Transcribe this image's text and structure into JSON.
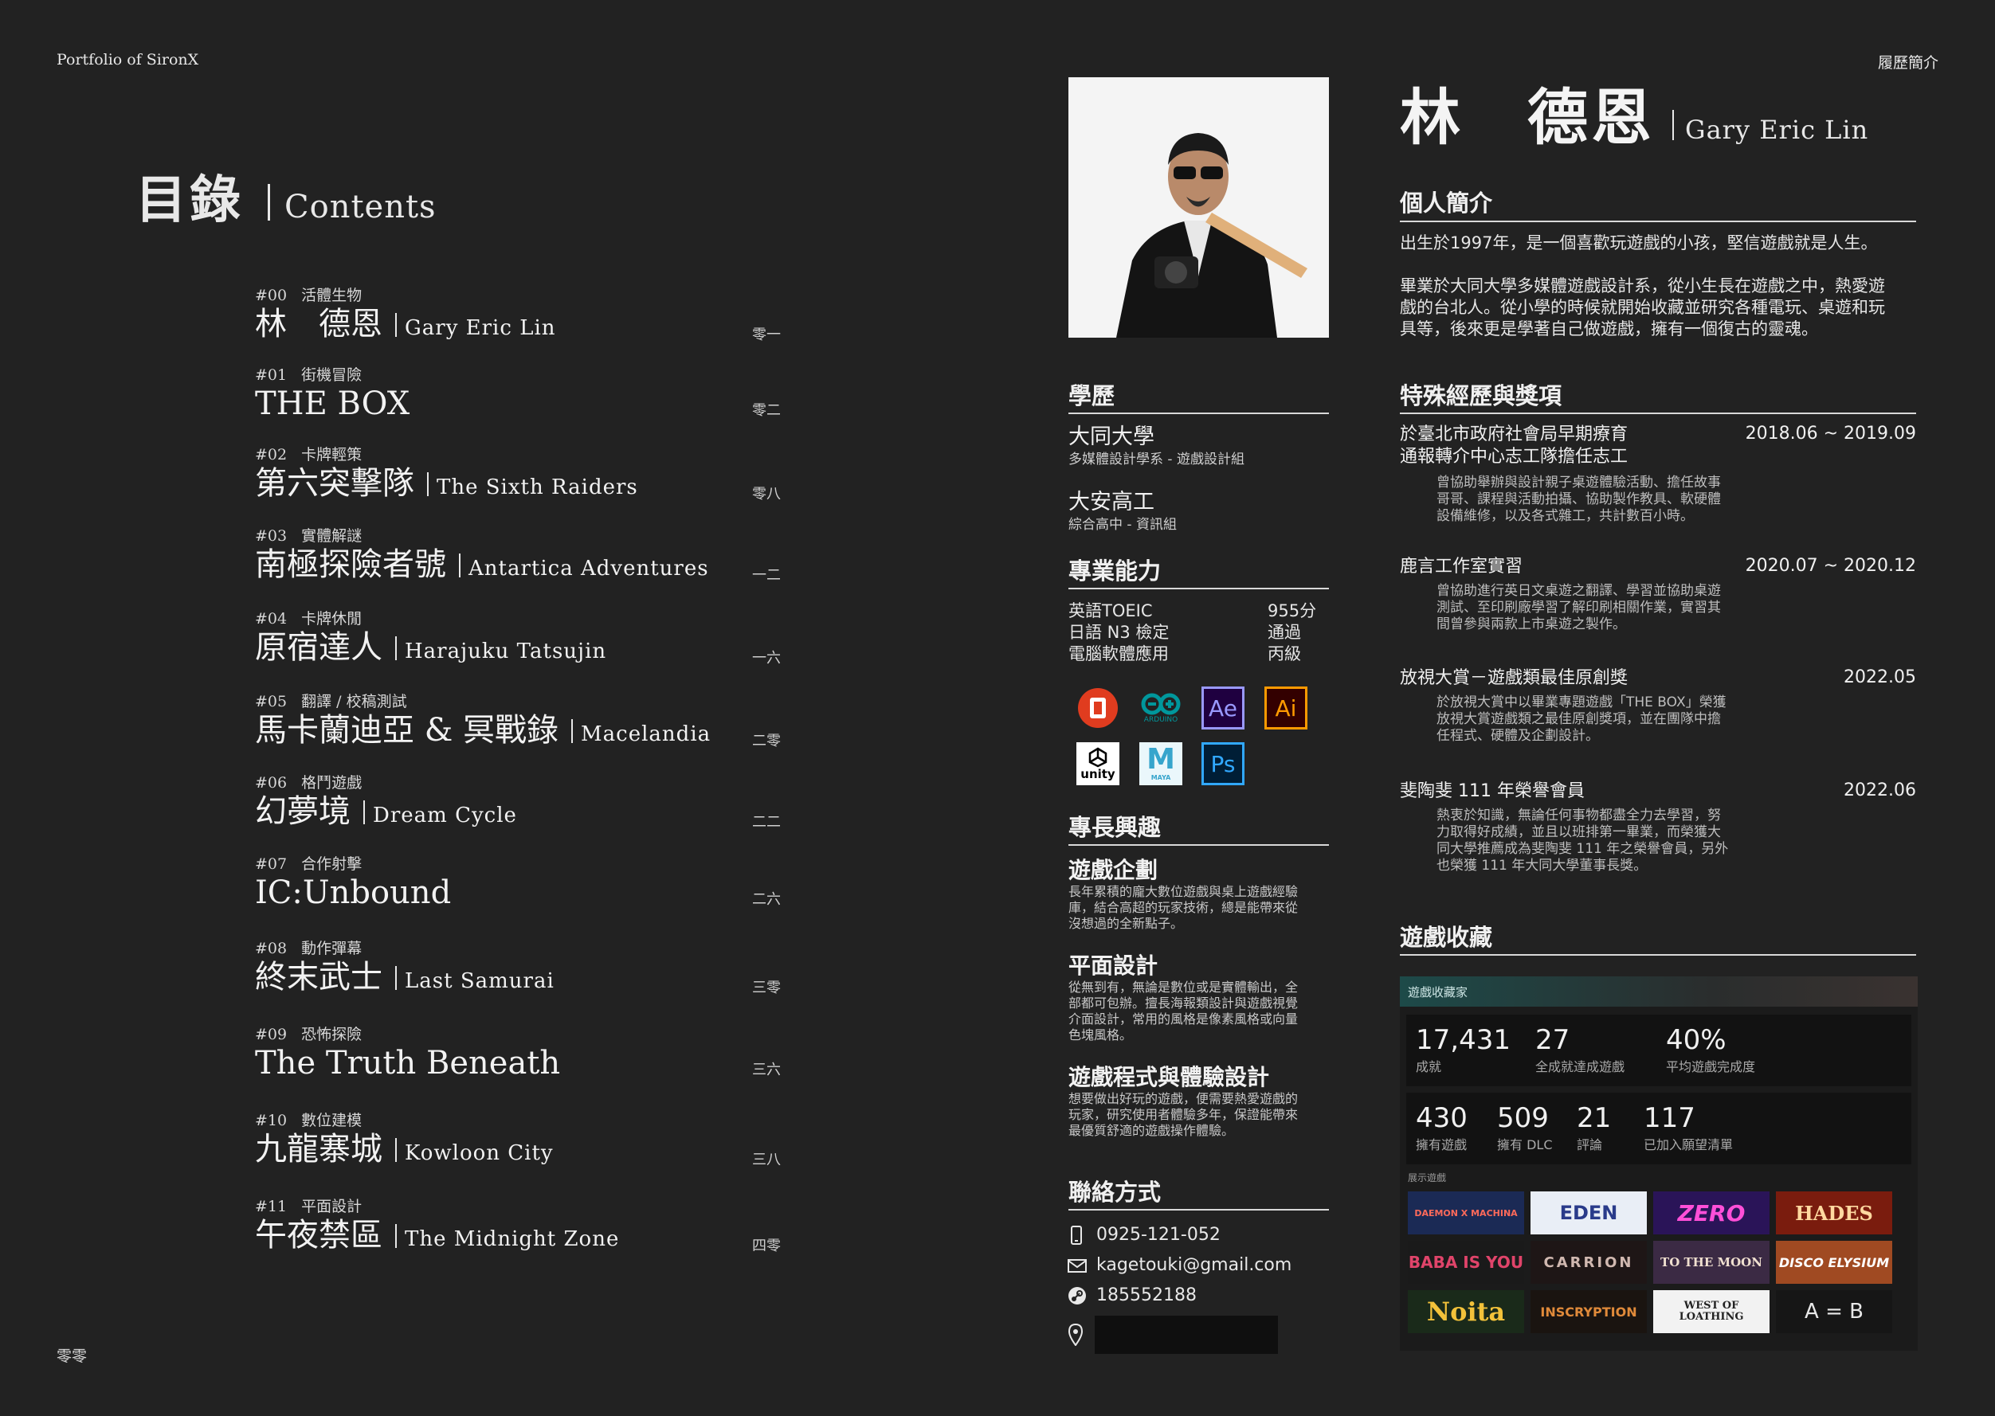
{
  "header": {
    "left": "Portfolio of SironX",
    "right": "履歷簡介"
  },
  "footer": {
    "page_left": "零零"
  },
  "toc": {
    "title_zh": "目錄",
    "title_en": "Contents",
    "entries": [
      {
        "num": "#00",
        "tag": "活體生物",
        "title": "林　德恩",
        "subtitle": "Gary Eric Lin",
        "page": "零一"
      },
      {
        "num": "#01",
        "tag": "街機冒險",
        "title": "THE BOX",
        "subtitle": "",
        "page": "零二"
      },
      {
        "num": "#02",
        "tag": "卡牌輕策",
        "title": "第六突擊隊",
        "subtitle": "The Sixth Raiders",
        "page": "零八"
      },
      {
        "num": "#03",
        "tag": "實體解謎",
        "title": "南極探險者號",
        "subtitle": "Antartica Adventures",
        "page": "一二"
      },
      {
        "num": "#04",
        "tag": "卡牌休閒",
        "title": "原宿達人",
        "subtitle": "Harajuku Tatsujin",
        "page": "一六"
      },
      {
        "num": "#05",
        "tag": "翻譯 / 校稿測試",
        "title": "馬卡蘭迪亞 & 冥戰錄",
        "subtitle": "Macelandia",
        "page": "二零"
      },
      {
        "num": "#06",
        "tag": "格鬥遊戲",
        "title": "幻夢境",
        "subtitle": "Dream Cycle",
        "page": "二二"
      },
      {
        "num": "#07",
        "tag": "合作射擊",
        "title": "IC:Unbound",
        "subtitle": "",
        "page": "二六"
      },
      {
        "num": "#08",
        "tag": "動作彈幕",
        "title": "終末武士",
        "subtitle": "Last Samurai",
        "page": "三零"
      },
      {
        "num": "#09",
        "tag": "恐怖探險",
        "title": "The Truth Beneath",
        "subtitle": "",
        "page": "三六"
      },
      {
        "num": "#10",
        "tag": "數位建模",
        "title": "九龍寨城",
        "subtitle": "Kowloon City",
        "page": "三八"
      },
      {
        "num": "#11",
        "tag": "平面設計",
        "title": "午夜禁區",
        "subtitle": "The Midnight Zone",
        "page": "四零"
      }
    ]
  },
  "profile": {
    "name_zh": "林　德恩",
    "name_en": "Gary Eric Lin",
    "intro_title": "個人簡介",
    "intro_p1": "出生於1997年，是一個喜歡玩遊戲的小孩，堅信遊戲就是人生。",
    "intro_p2_l1": "畢業於大同大學多媒體遊戲設計系，從小生長在遊戲之中，熱愛遊",
    "intro_p2_l2": "戲的台北人。從小學的時候就開始收藏並研究各種電玩、桌遊和玩",
    "intro_p2_l3": "具等，後來更是學著自己做遊戲，擁有一個復古的靈魂。"
  },
  "education": {
    "title": "學歷",
    "items": [
      {
        "school": "大同大學",
        "detail": "多媒體設計學系 - 遊戲設計組"
      },
      {
        "school": "大安高工",
        "detail": "綜合高中 - 資訊組"
      }
    ]
  },
  "skills": {
    "title": "專業能力",
    "rows": [
      {
        "label": "英語TOEIC",
        "value": "955分"
      },
      {
        "label": "日語 N3 檢定",
        "value": "通過"
      },
      {
        "label": "電腦軟體應用",
        "value": "丙級"
      }
    ],
    "icons": [
      {
        "name": "office-icon",
        "text": "",
        "color": "#e03c1f"
      },
      {
        "name": "arduino-icon",
        "text": "ARDUINO",
        "color": "#00979c"
      },
      {
        "name": "after-effects-icon",
        "text": "Ae",
        "color": "#9999ff"
      },
      {
        "name": "illustrator-icon",
        "text": "Ai",
        "color": "#ff9a00"
      },
      {
        "name": "unity-icon",
        "text": "unity",
        "color": "#ffffff"
      },
      {
        "name": "maya-icon",
        "text": "MAYA",
        "color": "#37a5cc"
      },
      {
        "name": "photoshop-icon",
        "text": "Ps",
        "color": "#31a8ff"
      }
    ]
  },
  "interests": {
    "title": "專長興趣",
    "items": [
      {
        "title": "遊戲企劃",
        "lines": [
          "長年累積的龐大數位遊戲與桌上遊戲經驗",
          "庫，結合高超的玩家技術，總是能帶來從",
          "沒想過的全新點子。"
        ]
      },
      {
        "title": "平面設計",
        "lines": [
          "從無到有，無論是數位或是實體輸出，全",
          "部都可包辦。擅長海報類設計與遊戲視覺",
          "介面設計，常用的風格是像素風格或向量",
          "色塊風格。"
        ]
      },
      {
        "title": "遊戲程式與體驗設計",
        "lines": [
          "想要做出好玩的遊戲，便需要熱愛遊戲的",
          "玩家，研究使用者體驗多年，保證能帶來",
          "最優質舒適的遊戲操作體驗。"
        ]
      }
    ]
  },
  "contact": {
    "title": "聯絡方式",
    "phone": "0925-121-052",
    "email": "kagetouki@gmail.com",
    "steam": "185552188"
  },
  "experience": {
    "title": "特殊經歷與獎項",
    "items": [
      {
        "title_l1": "於臺北市政府社會局早期療育",
        "title_l2": "通報轉介中心志工隊擔任志工",
        "date": "2018.06 ~ 2019.09",
        "desc": [
          "曾協助舉辦與設計親子桌遊體驗活動、擔任故事",
          "哥哥、課程與活動拍攝、協助製作教具、軟硬體",
          "設備維修，以及各式雜工，共計數百小時。"
        ]
      },
      {
        "title_l1": "鹿言工作室實習",
        "title_l2": "",
        "date": "2020.07 ~ 2020.12",
        "desc": [
          "曾協助進行英日文桌遊之翻譯、學習並協助桌遊",
          "測試、至印刷廠學習了解印刷相關作業，實習其",
          "間曾參與兩款上市桌遊之製作。"
        ]
      },
      {
        "title_l1": "放視大賞－遊戲類最佳原創獎",
        "title_l2": "",
        "date": "2022.05",
        "desc": [
          "於放視大賞中以畢業專題遊戲「THE BOX」榮獲",
          "放視大賞遊戲類之最佳原創獎項，並在團隊中擔",
          "任程式、硬體及企劃設計。"
        ]
      },
      {
        "title_l1": "斐陶斐 111 年榮譽會員",
        "title_l2": "",
        "date": "2022.06",
        "desc": [
          "熱衷於知識，無論任何事物都盡全力去學習，努",
          "力取得好成績，並且以班排第一畢業，而榮獲大",
          "同大學推薦成為斐陶斐 111 年之榮譽會員，另外",
          "也榮獲 111 年大同大學董事長獎。"
        ]
      }
    ]
  },
  "collection": {
    "title": "遊戲收藏",
    "panel_header": "遊戲收藏家",
    "stats_row1": [
      {
        "value": "17,431",
        "label": "成就"
      },
      {
        "value": "27",
        "label": "全成就達成遊戲"
      },
      {
        "value": "40%",
        "label": "平均遊戲完成度"
      }
    ],
    "stats_row2": [
      {
        "value": "430",
        "label": "擁有遊戲"
      },
      {
        "value": "509",
        "label": "擁有 DLC"
      },
      {
        "value": "21",
        "label": "評論"
      },
      {
        "value": "117",
        "label": "已加入願望清單"
      }
    ],
    "showcase_label": "展示遊戲",
    "games": [
      "DAEMON X MACHINA",
      "EDEN",
      "ZERO",
      "HADES",
      "BABA IS YOU",
      "CARRION",
      "TO THE MOON",
      "DISCO ELYSIUM",
      "Noita",
      "INSCRYPTION",
      "WEST OF LOATHING",
      "A = B"
    ]
  }
}
